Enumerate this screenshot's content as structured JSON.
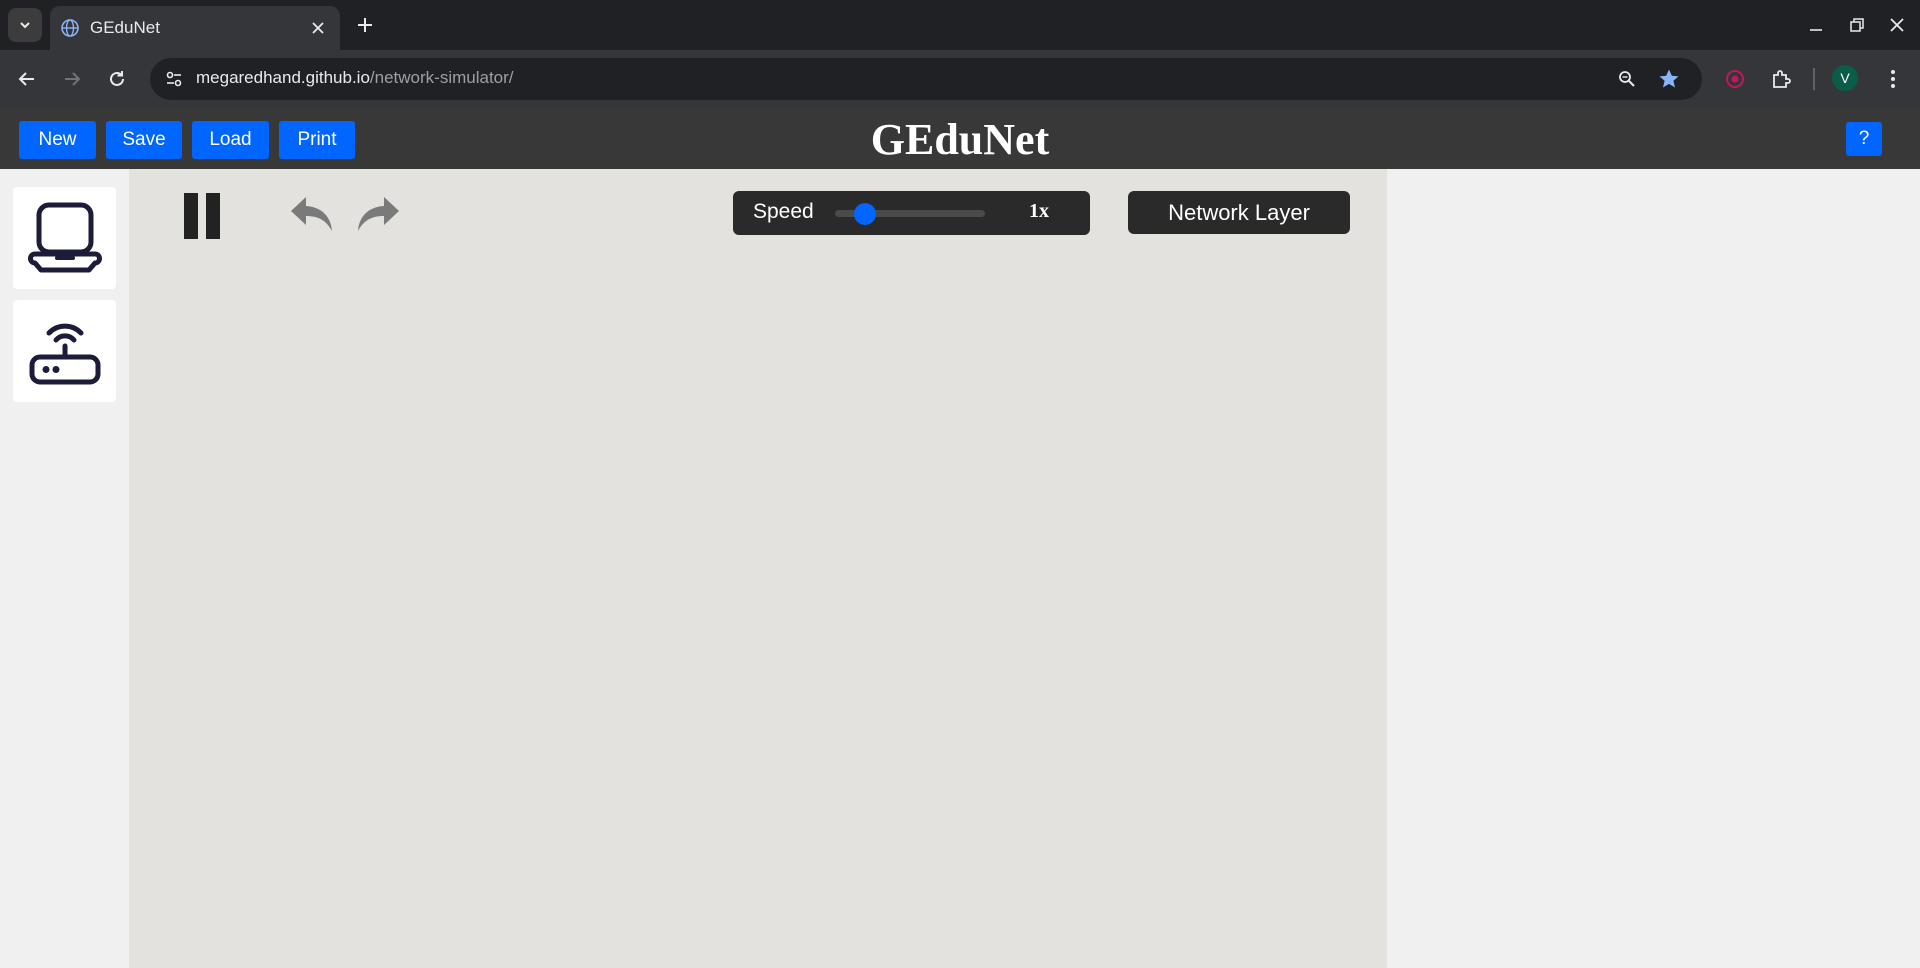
{
  "browser": {
    "tab_title": "GEduNet",
    "url_host": "megaredhand.github.io",
    "url_path": "/network-simulator/",
    "avatar_letter": "V"
  },
  "header": {
    "title": "GEduNet",
    "buttons": {
      "new": "New",
      "save": "Save",
      "load": "Load",
      "print": "Print"
    },
    "help": "?"
  },
  "toolbox": {
    "items": [
      {
        "icon": "laptop-icon"
      },
      {
        "icon": "router-icon"
      }
    ]
  },
  "controls": {
    "speed_label": "Speed",
    "speed_value": "1x",
    "speed_level": 0.2,
    "layer_button": "Network Layer"
  },
  "colors": {
    "accent": "#0066ff",
    "header_bg": "#383838",
    "canvas_bg": "#e3e2df",
    "icon_stroke": "#1d1b3a"
  }
}
